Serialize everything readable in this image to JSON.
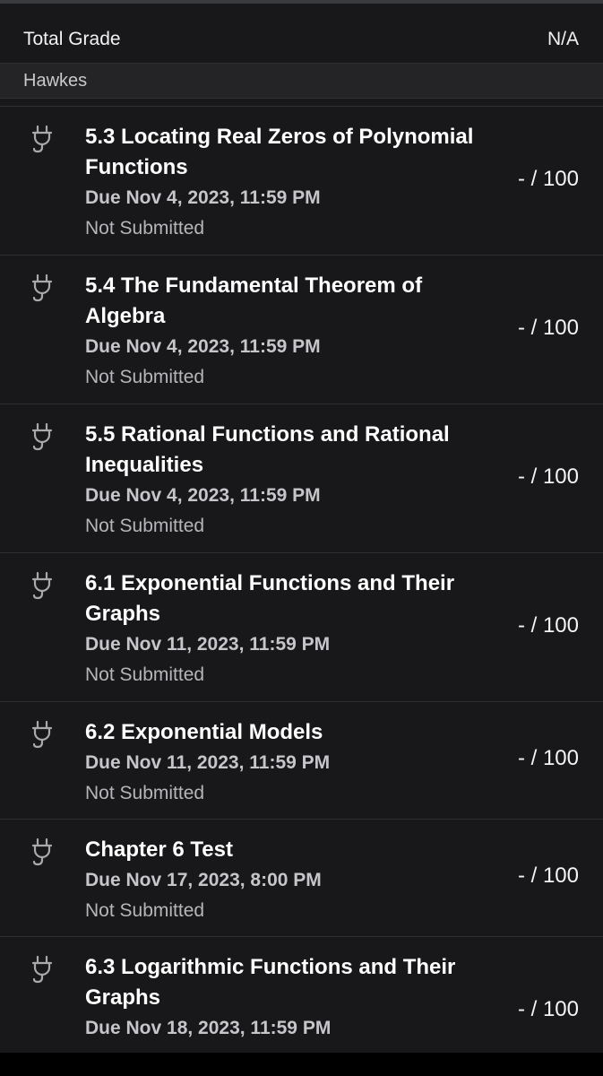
{
  "total": {
    "label": "Total Grade",
    "value": "N/A"
  },
  "group": {
    "label": "Hawkes"
  },
  "icon": "plug-icon",
  "assignments": [
    {
      "title_line1": "5.3 Locating Real Zeros of Polynomial",
      "title_line2": "Functions",
      "due": "Due Nov 4, 2023, 11:59 PM",
      "status": "Not Submitted",
      "score": "- / 100"
    },
    {
      "title_line1": "5.4 The Fundamental Theorem of",
      "title_line2": "Algebra",
      "due": "Due Nov 4, 2023, 11:59 PM",
      "status": "Not Submitted",
      "score": "- / 100"
    },
    {
      "title_line1": "5.5 Rational Functions and Rational",
      "title_line2": "Inequalities",
      "due": "Due Nov 4, 2023, 11:59 PM",
      "status": "Not Submitted",
      "score": "- / 100"
    },
    {
      "title_line1": "6.1 Exponential Functions and Their",
      "title_line2": "Graphs",
      "due": "Due Nov 11, 2023, 11:59 PM",
      "status": "Not Submitted",
      "score": "- / 100"
    },
    {
      "title_line1": "6.2 Exponential Models",
      "title_line2": "",
      "due": "Due Nov 11, 2023, 11:59 PM",
      "status": "Not Submitted",
      "score": "- / 100"
    },
    {
      "title_line1": "Chapter 6 Test",
      "title_line2": "",
      "due": "Due Nov 17, 2023, 8:00 PM",
      "status": "Not Submitted",
      "score": "- / 100"
    },
    {
      "title_line1": "6.3 Logarithmic Functions and Their",
      "title_line2": "Graphs",
      "due": "Due Nov 18, 2023, 11:59 PM",
      "status": "",
      "score": "- / 100"
    }
  ]
}
